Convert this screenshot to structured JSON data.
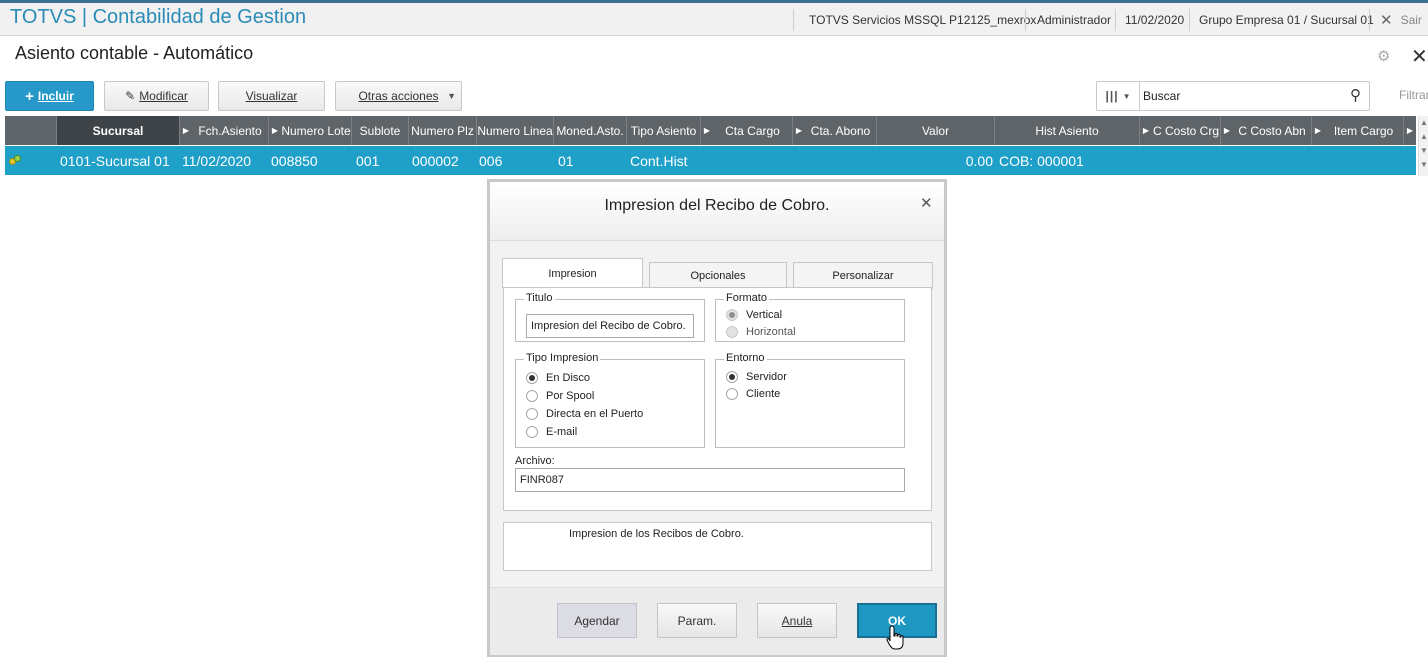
{
  "topbar": {
    "app_title": "TOTVS | Contabilidad de Gestion",
    "environment": "TOTVS Servicios MSSQL P12125_mexrox",
    "user": "Administrador",
    "date": "11/02/2020",
    "company": "Grupo Empresa 01 / Sucursal 01",
    "exit_label": "Sair"
  },
  "page": {
    "title": "Asiento contable - Automático"
  },
  "toolbar": {
    "incluir": "Incluir",
    "modificar": "Modificar",
    "visualizar": "Visualizar",
    "otras_acciones": "Otras acciones",
    "search_value": "Buscar",
    "filter": "Filtrar"
  },
  "grid": {
    "columns": [
      "Sucursal",
      "Fch.Asiento",
      "Numero Lote",
      "Sublote",
      "Numero Plz",
      "Numero Linea",
      "Moned.Asto.",
      "Tipo Asiento",
      "Cta Cargo",
      "Cta. Abono",
      "Valor",
      "Hist Asiento",
      "C Costo Crg",
      "C Costo Abn",
      "Item Cargo"
    ],
    "rows": [
      {
        "sucursal": "0101-Sucursal 01",
        "fecha": "11/02/2020",
        "lote": "008850",
        "sublote": "001",
        "plz": "000002",
        "linea": "006",
        "moneda": "01",
        "tipo": "Cont.Hist",
        "valor": "0.00",
        "hist": "COB: 000001"
      }
    ]
  },
  "dialog": {
    "title": "Impresion del Recibo de Cobro.",
    "tabs": [
      "Impresion",
      "Opcionales",
      "Personalizar"
    ],
    "titulo_label": "Titulo",
    "titulo_value": "Impresion del Recibo de Cobro.",
    "formato_label": "Formato",
    "formato_options": [
      "Vertical",
      "Horizontal"
    ],
    "tipo_label": "Tipo Impresion",
    "tipo_options": [
      "En Disco",
      "Por Spool",
      "Directa en el Puerto",
      "E-mail"
    ],
    "entorno_label": "Entorno",
    "entorno_options": [
      "Servidor",
      "Cliente"
    ],
    "archivo_label": "Archivo:",
    "archivo_value": "FINR087",
    "description": "Impresion de los Recibos de Cobro.",
    "buttons": {
      "agendar": "Agendar",
      "param": "Param.",
      "anula": "Anula",
      "ok": "OK"
    }
  },
  "colors": {
    "brand": "#2a8bb6",
    "primary_button": "#2699c9",
    "grid_header": "#5f6468",
    "selected_row": "#1fa0c8"
  }
}
